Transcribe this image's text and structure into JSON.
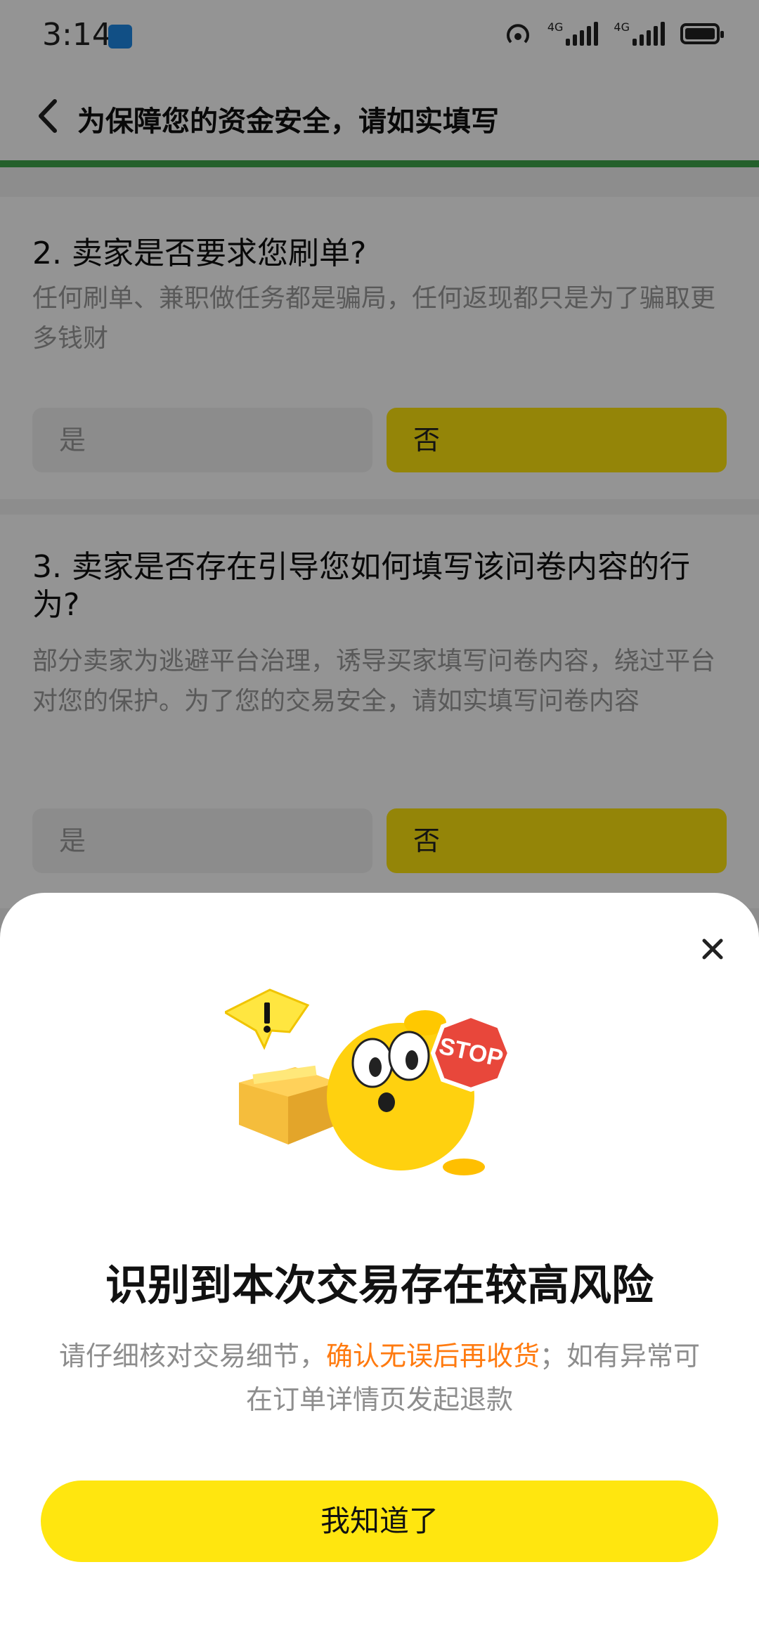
{
  "status_bar": {
    "time": "3:14",
    "net_label_1": "4G",
    "net_label_2": "4G"
  },
  "header": {
    "title": "为保障您的资金安全，请如实填写"
  },
  "questions": [
    {
      "title": "2. 卖家是否要求您刷单?",
      "desc": "任何刷单、兼职做任务都是骗局，任何返现都只是为了骗取更多钱财",
      "option_yes": "是",
      "option_no": "否"
    },
    {
      "title": "3. 卖家是否存在引导您如何填写该问卷内容的行为?",
      "desc": "部分卖家为逃避平台治理，诱导买家填写问卷内容，绕过平台对您的保护。为了您的交易安全，请如实填写问卷内容",
      "option_yes": "是",
      "option_no": "否"
    }
  ],
  "modal": {
    "illustration_sign": "STOP",
    "title": "识别到本次交易存在较高风险",
    "text_part1": "请仔细核对交易细节，",
    "text_highlight": "确认无误后再收货",
    "text_part2": "；如有异常可在订单详情页发起退款",
    "button_label": "我知道了"
  },
  "colors": {
    "accent_yellow": "#ffe60f",
    "highlight_orange": "#ff7a0f",
    "progress_green": "#3fa64a"
  }
}
